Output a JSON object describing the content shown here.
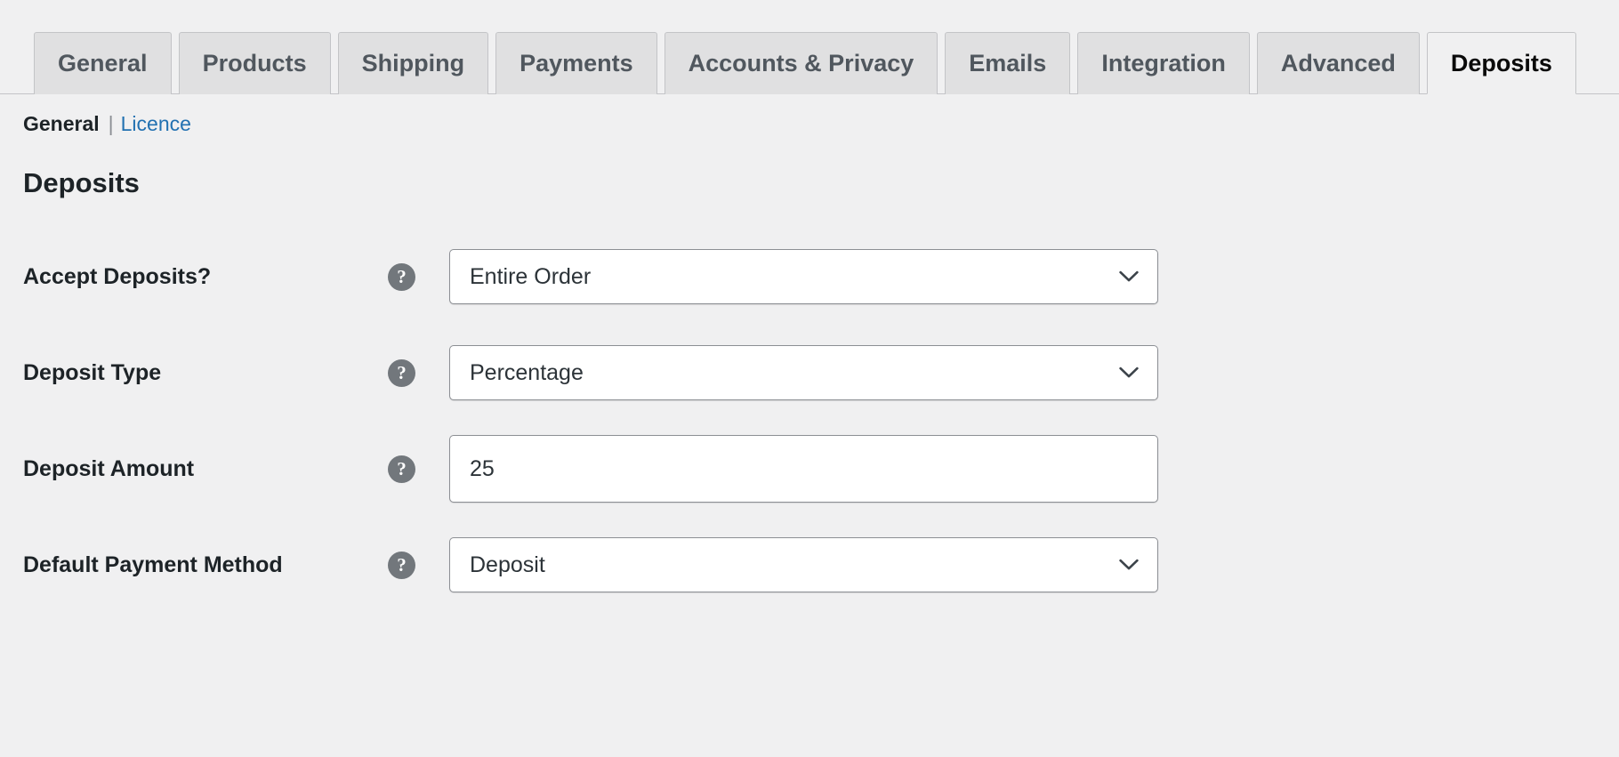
{
  "tabs": [
    {
      "label": "General",
      "active": false
    },
    {
      "label": "Products",
      "active": false
    },
    {
      "label": "Shipping",
      "active": false
    },
    {
      "label": "Payments",
      "active": false
    },
    {
      "label": "Accounts & Privacy",
      "active": false
    },
    {
      "label": "Emails",
      "active": false
    },
    {
      "label": "Integration",
      "active": false
    },
    {
      "label": "Advanced",
      "active": false
    },
    {
      "label": "Deposits",
      "active": true
    }
  ],
  "subnav": {
    "current": "General",
    "separator": "|",
    "link": "Licence"
  },
  "page": {
    "title": "Deposits"
  },
  "help_icon": "?",
  "chevron_icon": "chevron-down-icon",
  "fields": [
    {
      "label": "Accept Deposits?",
      "type": "select",
      "value": "Entire Order",
      "options": [
        "Entire Order"
      ]
    },
    {
      "label": "Deposit Type",
      "type": "select",
      "value": "Percentage",
      "options": [
        "Percentage"
      ]
    },
    {
      "label": "Deposit Amount",
      "type": "text",
      "value": "25",
      "placeholder": ""
    },
    {
      "label": "Default Payment Method",
      "type": "select",
      "value": "Deposit",
      "options": [
        "Deposit"
      ]
    }
  ],
  "colors": {
    "page_background": "#f0f0f1",
    "tab_inactive": "#e0e0e1",
    "tab_border": "#c3c4c7",
    "link": "#2271b1",
    "text": "#1d2327",
    "help_icon_bg": "#72777c",
    "field_border": "#8c8f94"
  }
}
